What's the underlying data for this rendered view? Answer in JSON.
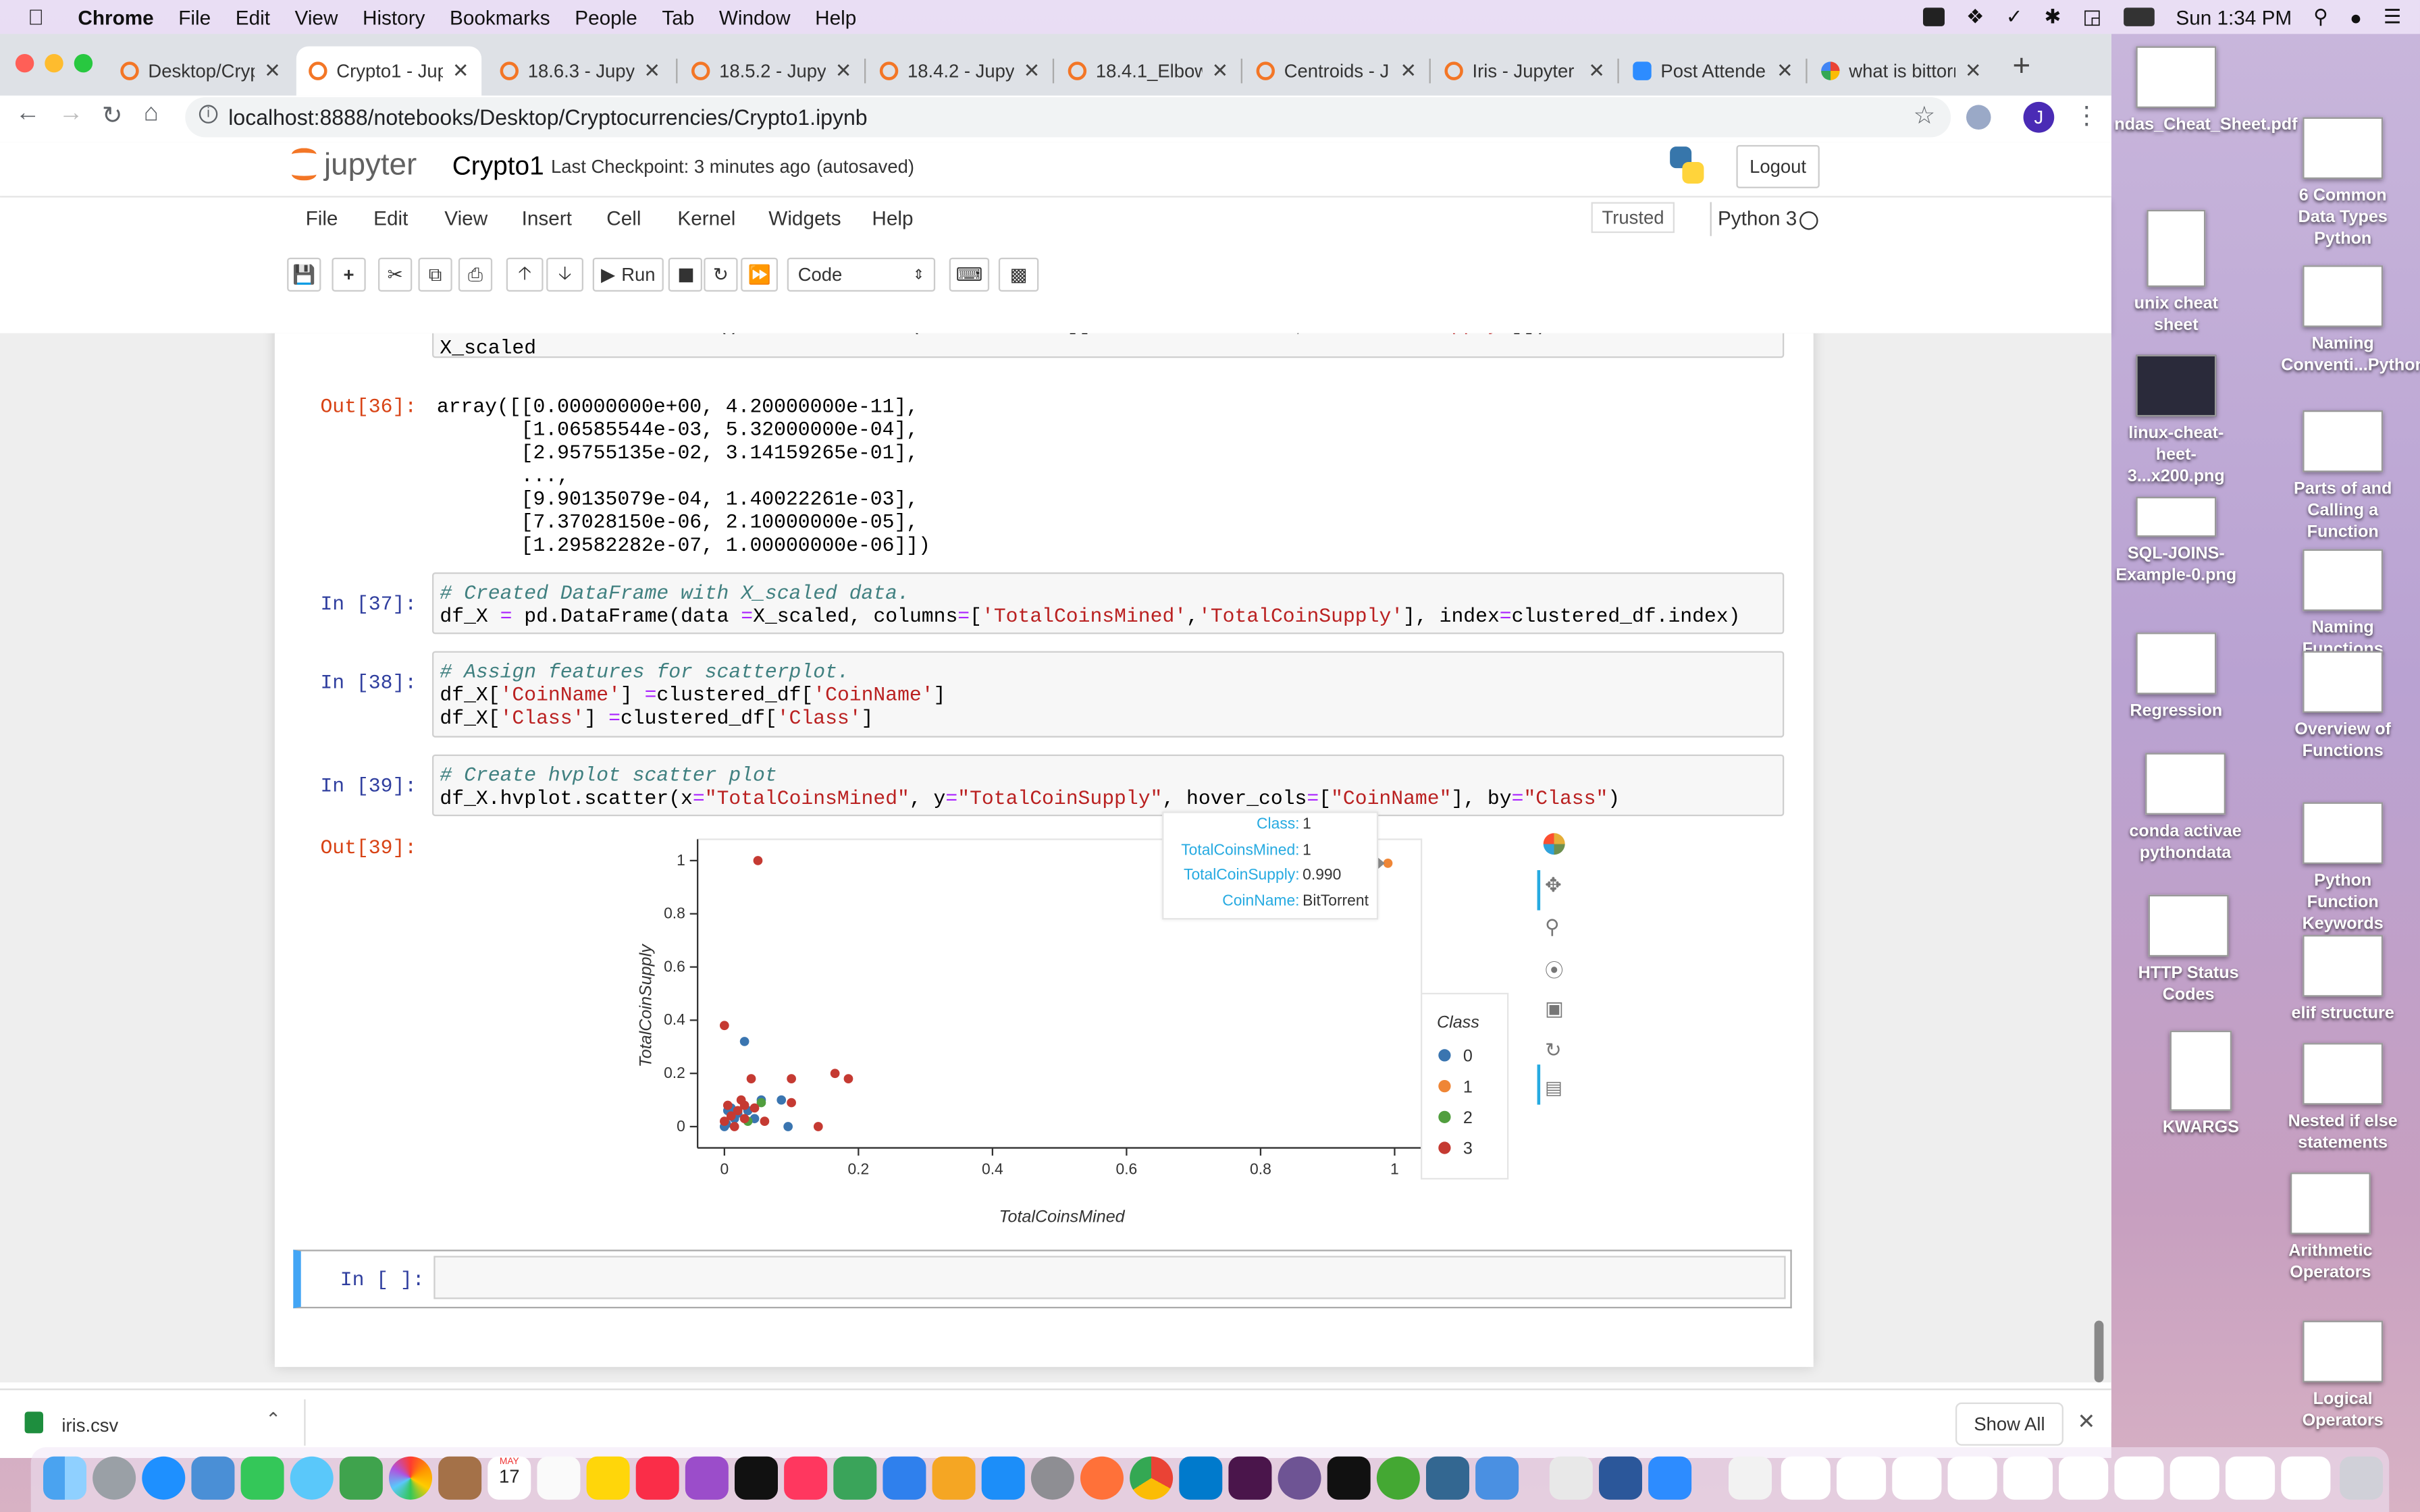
{
  "menubar": {
    "app": "Chrome",
    "items": [
      "File",
      "Edit",
      "View",
      "History",
      "Bookmarks",
      "People",
      "Tab",
      "Window",
      "Help"
    ],
    "clock": "Sun 1:34 PM"
  },
  "tabs": [
    {
      "title": "Desktop/Cryp"
    },
    {
      "title": "Crypto1 - Jup"
    },
    {
      "title": "18.6.3 - Jupy"
    },
    {
      "title": "18.5.2 - Jupy"
    },
    {
      "title": "18.4.2 - Jupy"
    },
    {
      "title": "18.4.1_Elbow"
    },
    {
      "title": "Centroids - J"
    },
    {
      "title": "Iris - Jupyter"
    },
    {
      "title": "Post Attende"
    },
    {
      "title": "what is bittorr"
    }
  ],
  "address": {
    "url": "localhost:8888/notebooks/Desktop/Cryptocurrencies/Crypto1.ipynb",
    "avatar": "J"
  },
  "jupyter": {
    "logo_text": "jupyter",
    "notebook_name": "Crypto1",
    "checkpoint": "Last Checkpoint: 3 minutes ago",
    "autosave": "(autosaved)",
    "logout": "Logout",
    "menu": [
      "File",
      "Edit",
      "View",
      "Insert",
      "Cell",
      "Kernel",
      "Widgets",
      "Help"
    ],
    "trusted": "Trusted",
    "kernel": "Python 3",
    "run_label": "Run",
    "cell_type": "Code"
  },
  "cells": {
    "c36_line1": "X_scaled = MinMaxScaler().fit_transform(clustered_df[['TotalCoinsMined','TotalCoinSupply']])",
    "c36_line2": "X_scaled",
    "out36_prompt": "Out[36]:",
    "out36_text": "array([[0.00000000e+00, 4.20000000e-11],\n       [1.06585544e-03, 5.32000000e-04],\n       [2.95755135e-02, 3.14159265e-01],\n       ...,\n       [9.90135079e-04, 1.40022261e-03],\n       [7.37028150e-06, 2.10000000e-05],\n       [1.29582282e-07, 1.00000000e-06]])",
    "in37_prompt": "In [37]:",
    "in37_comment": "# Created DataFrame with X_scaled data.",
    "in37_code": "df_X = pd.DataFrame(data =X_scaled, columns=['TotalCoinsMined','TotalCoinSupply'], index=clustered_df.index)",
    "in38_prompt": "In [38]:",
    "in38_comment": "# Assign features for scatterplot.",
    "in38_line1": "df_X['CoinName'] =clustered_df['CoinName']",
    "in38_line2": "df_X['Class'] =clustered_df['Class']",
    "in39_prompt": "In [39]:",
    "in39_comment": "# Create hvplot scatter plot",
    "in39_code": "df_X.hvplot.scatter(x=\"TotalCoinsMined\", y=\"TotalCoinSupply\", hover_cols=[\"CoinName\"], by=\"Class\")",
    "out39_prompt": "Out[39]:",
    "empty_prompt": "In [ ]:"
  },
  "chart_data": {
    "type": "scatter",
    "xlabel": "TotalCoinsMined",
    "ylabel": "TotalCoinSupply",
    "xlim": [
      -0.04,
      1.04
    ],
    "ylim": [
      -0.08,
      1.08
    ],
    "xticks": [
      "0",
      "0.2",
      "0.4",
      "0.6",
      "0.8",
      "1"
    ],
    "yticks": [
      "0",
      "0.2",
      "0.4",
      "0.6",
      "0.8",
      "1"
    ],
    "legend_title": "Class",
    "legend_position": "right",
    "series": [
      {
        "name": "0",
        "color": "#30a2da",
        "points": [
          [
            0.0,
            0.0
          ],
          [
            0.003,
            0.01
          ],
          [
            0.005,
            0.06
          ],
          [
            0.01,
            0.07
          ],
          [
            0.02,
            0.05
          ],
          [
            0.03,
            0.32
          ],
          [
            0.035,
            0.06
          ],
          [
            0.045,
            0.03
          ],
          [
            0.055,
            0.1
          ],
          [
            0.085,
            0.1
          ],
          [
            0.095,
            0.0
          ],
          [
            0.015,
            0.03
          ]
        ]
      },
      {
        "name": "1",
        "color": "#fc4f30",
        "points": [
          [
            0.99,
            0.99
          ]
        ]
      },
      {
        "name": "2",
        "color": "#e5ae38",
        "points": [
          [
            0.055,
            0.09
          ],
          [
            0.035,
            0.02
          ]
        ]
      },
      {
        "name": "3",
        "color": "#6d904f",
        "points": [
          [
            0.05,
            1.0
          ],
          [
            0.0,
            0.38
          ],
          [
            0.0,
            0.02
          ],
          [
            0.005,
            0.08
          ],
          [
            0.01,
            0.04
          ],
          [
            0.02,
            0.06
          ],
          [
            0.025,
            0.1
          ],
          [
            0.03,
            0.03
          ],
          [
            0.04,
            0.18
          ],
          [
            0.045,
            0.07
          ],
          [
            0.1,
            0.18
          ],
          [
            0.1,
            0.09
          ],
          [
            0.14,
            0.0
          ],
          [
            0.165,
            0.2
          ],
          [
            0.185,
            0.18
          ],
          [
            0.03,
            0.08
          ],
          [
            0.015,
            0.0
          ],
          [
            0.06,
            0.02
          ]
        ]
      }
    ],
    "series_colors_rendered": [
      "#3a75b0",
      "#ef8636",
      "#519e3e",
      "#c53a32"
    ],
    "hover": {
      "Class": "1",
      "TotalCoinsMined": "1",
      "TotalCoinSupply": "0.990",
      "CoinName": "BitTorrent"
    }
  },
  "hover_labels": {
    "class": "Class:",
    "mined": "TotalCoinsMined:",
    "supply": "TotalCoinSupply:",
    "coin": "CoinName:"
  },
  "download": {
    "file": "iris.csv",
    "show_all": "Show All"
  },
  "desktop_icons": [
    "ndas_Cheat_Sheet.pdf",
    "6 Common Data Types Python",
    "unix cheat sheet",
    "Naming Conventi...Python",
    "linux-cheat-heet-3...x200.png",
    "Parts of and Calling a Function",
    "SQL-JOINS-Example-0.png",
    "Naming Functions",
    "Regression",
    "Overview of Functions",
    "conda activae pythondata",
    "Python Function Keywords",
    "HTTP Status Codes",
    "elif structure",
    "KWARGS",
    "Nested if else statements",
    "Arithmetic Operators",
    "Logical Operators"
  ],
  "dock_calendar": {
    "month": "MAY",
    "day": "17"
  }
}
